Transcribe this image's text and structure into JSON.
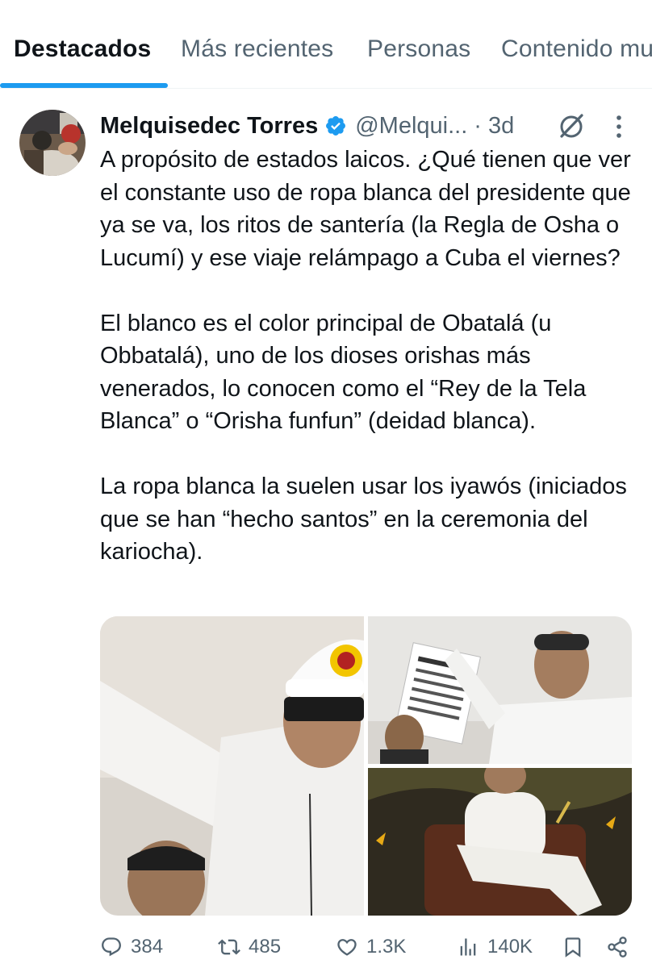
{
  "tabs": [
    {
      "label": "Destacados",
      "active": true
    },
    {
      "label": "Más recientes",
      "active": false
    },
    {
      "label": "Personas",
      "active": false
    },
    {
      "label": "Contenido mu",
      "active": false
    }
  ],
  "tweet": {
    "author_name": "Melquisedec Torres",
    "handle": "@Melqui...",
    "separator": "·",
    "time": "3d",
    "paragraphs": [
      "A propósito de estados laicos. ¿Qué tienen que ver el constante uso de ropa blanca del presidente que ya se va, los ritos de santería (la Regla de Osha o Lucumí) y ese viaje relámpago a Cuba el viernes?",
      "El blanco es el color principal de Obatalá (u Obbatalá), uno de los dioses orishas más venerados, lo conocen como el “Rey de la Tela Blanca” o “Orisha funfun” (deidad blanca).",
      "La ropa blanca la suelen usar los iyawós (iniciados que se han “hecho santos” en la ceremonia del kariocha)."
    ],
    "stats": {
      "replies": "384",
      "reposts": "485",
      "likes": "1.3K",
      "views": "140K"
    }
  },
  "icons": {
    "verified": "verified-badge-icon",
    "grok": "grok-icon",
    "more": "more-vertical-icon",
    "reply": "reply-icon",
    "repost": "repost-icon",
    "like": "like-icon",
    "views": "views-icon",
    "bookmark": "bookmark-icon",
    "share": "share-icon"
  },
  "colors": {
    "accent": "#1d9bf0",
    "text": "#0f1419",
    "muted": "#536471"
  }
}
